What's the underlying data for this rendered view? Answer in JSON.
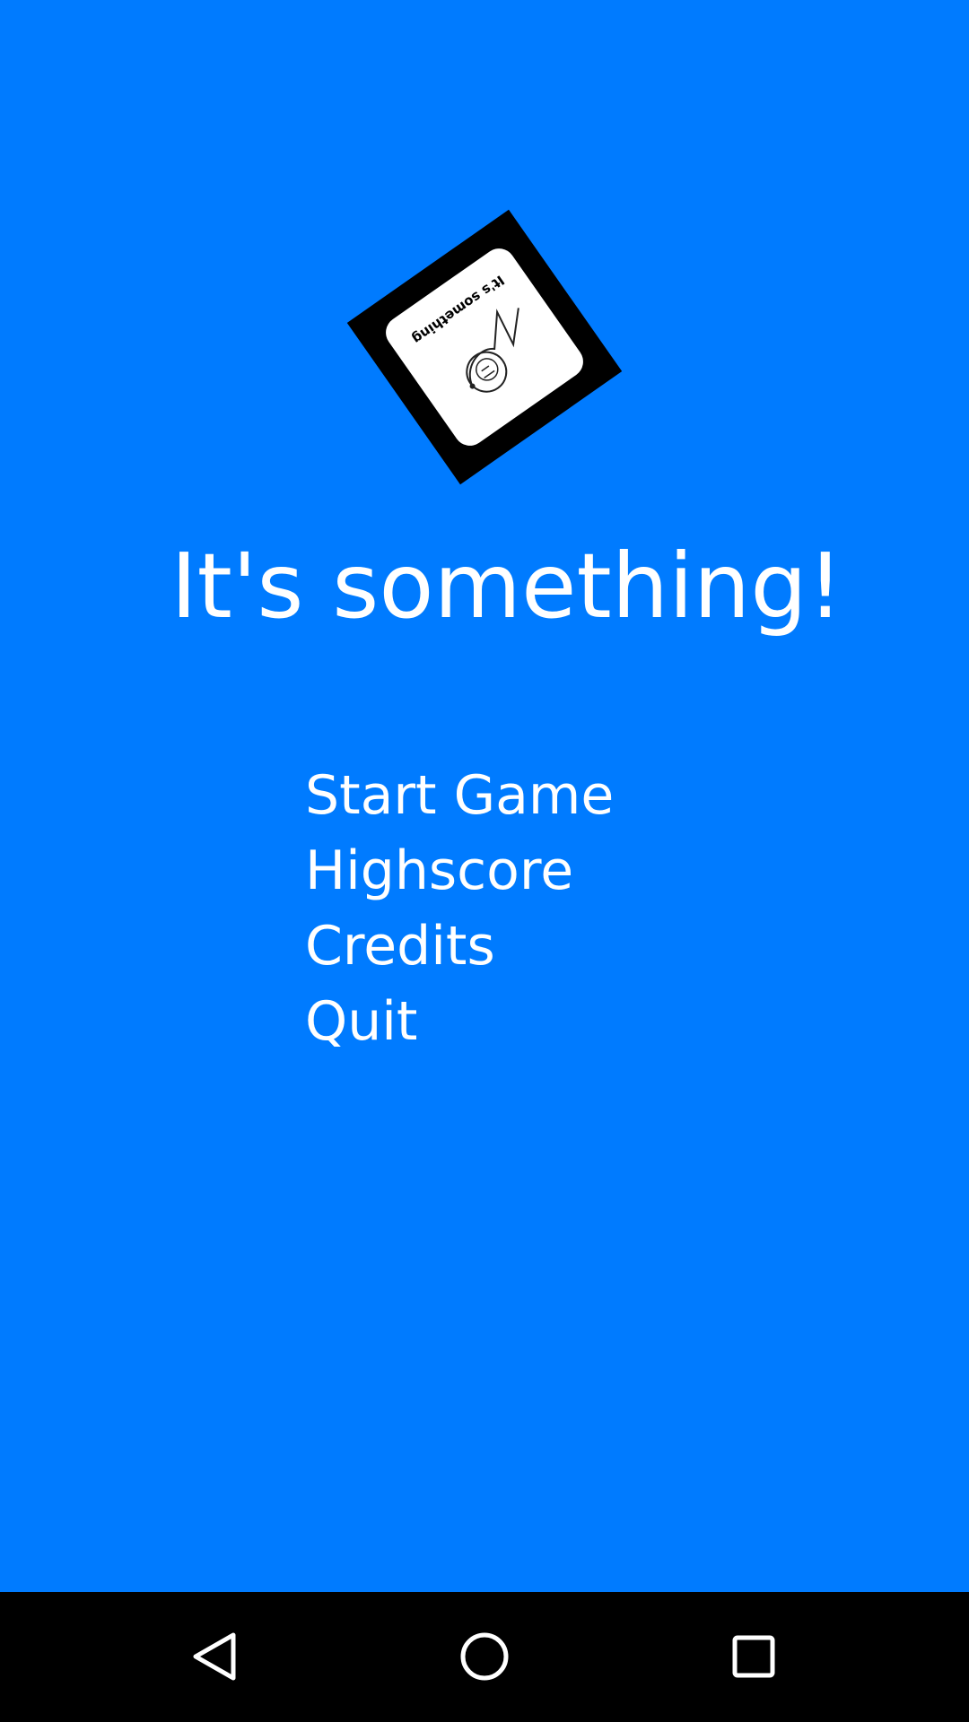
{
  "app": {
    "title": "It's something!",
    "logo_caption": "It's something"
  },
  "menu": {
    "items": [
      {
        "label": "Start Game"
      },
      {
        "label": "Highscore"
      },
      {
        "label": "Credits"
      },
      {
        "label": "Quit"
      }
    ]
  },
  "navbar": {
    "back_icon": "back-triangle-icon",
    "home_icon": "home-circle-icon",
    "recents_icon": "recents-square-icon"
  },
  "colors": {
    "background": "#007bff",
    "text": "#ffffff",
    "navbar": "#000000"
  }
}
